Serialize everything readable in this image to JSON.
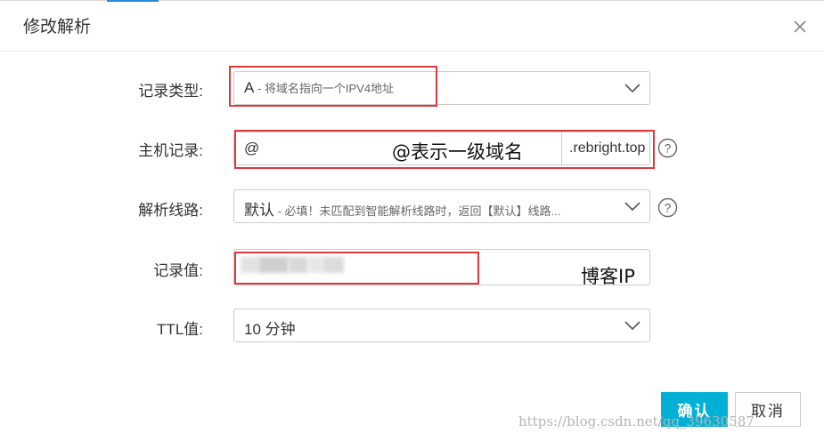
{
  "dialog": {
    "title": "修改解析",
    "close_icon": "close-icon"
  },
  "form": {
    "record_type": {
      "label": "记录类型:",
      "value": "A",
      "hint": " - 将域名指向一个IPV4地址"
    },
    "host": {
      "label": "主机记录:",
      "value": "@",
      "suffix": ".rebright.top",
      "annotation": "@表示一级域名"
    },
    "line": {
      "label": "解析线路:",
      "value": "默认",
      "hint": " - 必填！未匹配到智能解析线路时，返回【默认】线路..."
    },
    "record_value": {
      "label": "记录值:",
      "annotation": "博客IP"
    },
    "ttl": {
      "label": "TTL值:",
      "value": "10 分钟"
    }
  },
  "buttons": {
    "confirm": "确认",
    "cancel": "取消"
  },
  "watermark": "https://blog.csdn.net/qq_39630587",
  "colors": {
    "primary": "#00b0d6",
    "annotation_red": "#e0383e"
  }
}
